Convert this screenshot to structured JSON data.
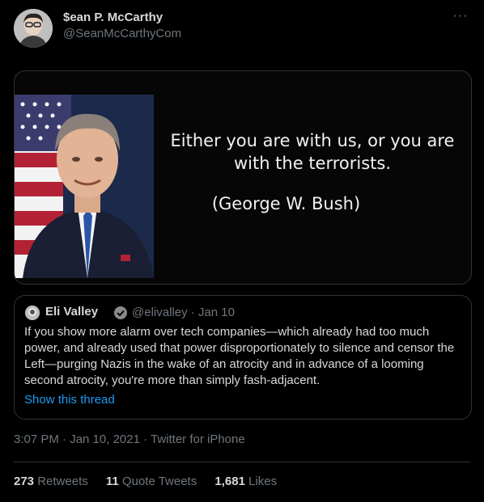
{
  "tweet": {
    "author_name": "$ean P. McCarthy",
    "author_handle": "@SeanMcCarthyCom",
    "more_label": "···",
    "media": {
      "quote_line": "Either you are with us, or you are with the terrorists.",
      "attribution": "(George W. Bush)"
    },
    "quoted_tweet": {
      "author_name": "Eli Valley",
      "meta": "@elivalley · Jan 10",
      "body": "If you show more alarm over tech companies—which already had too much power, and already used that power disproportionately to silence and censor the Left—purging Nazis in the wake of an atrocity and in advance of a looming second atrocity, you're more than simply fash-adjacent.",
      "show_thread": "Show this thread"
    },
    "timestamp": "3:07 PM · Jan 10, 2021 · Twitter for iPhone",
    "stats": {
      "retweets_count": "273",
      "retweets_label": "Retweets",
      "quotes_count": "11",
      "quotes_label": "Quote Tweets",
      "likes_count": "1,681",
      "likes_label": "Likes"
    }
  },
  "colors": {
    "background": "#000000",
    "text": "#d9d9d9",
    "muted": "#6e767d",
    "link": "#1d9bf0",
    "border": "#2f3336",
    "verified": "#8a8a8a"
  }
}
